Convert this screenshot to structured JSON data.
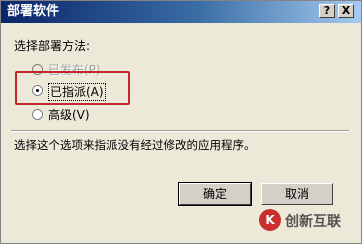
{
  "window": {
    "title": "部署软件",
    "help_button": "?",
    "close_button": "X"
  },
  "options_group": {
    "label": "选择部署方法:",
    "options": [
      {
        "label": "已发布(P)",
        "selected": false,
        "enabled": false
      },
      {
        "label": "已指派(A)",
        "selected": true,
        "enabled": true
      },
      {
        "label": "高级(V)",
        "selected": false,
        "enabled": true
      }
    ]
  },
  "description": "选择这个选项来指派没有经过修改的应用程序。",
  "buttons": {
    "ok": "确定",
    "cancel": "取消"
  },
  "watermark": {
    "logo_char": "K",
    "text": "创新互联"
  },
  "colors": {
    "highlight_border": "#c0282d",
    "titlebar_start": "#0a246a",
    "titlebar_end": "#a6caf0",
    "dialog_bg": "#ece9d8"
  }
}
